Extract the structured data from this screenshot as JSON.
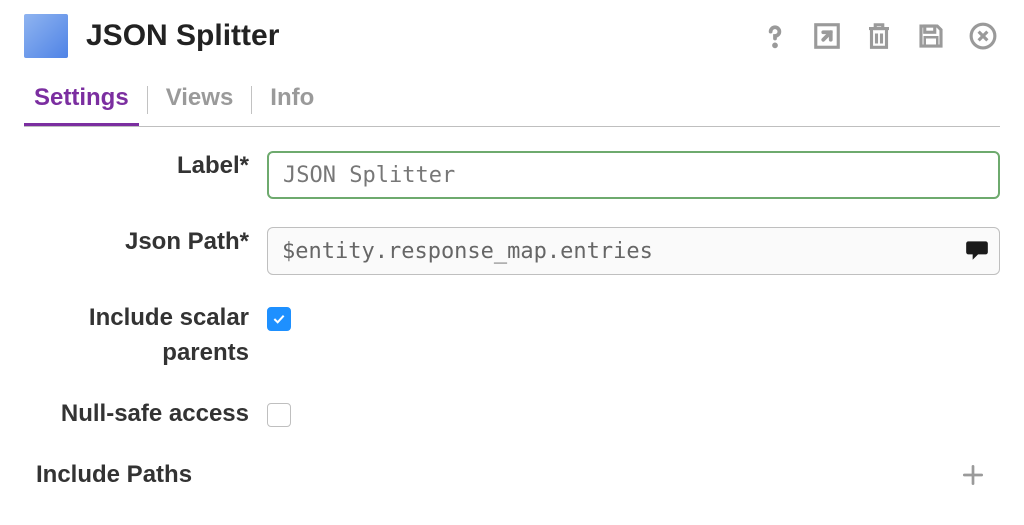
{
  "header": {
    "title": "JSON Splitter",
    "icons": {
      "help": "help-icon",
      "popout": "popout-icon",
      "delete": "trash-icon",
      "save": "save-icon",
      "close": "close-circle-icon"
    }
  },
  "tabs": {
    "active_index": 0,
    "items": [
      "Settings",
      "Views",
      "Info"
    ]
  },
  "form": {
    "label": {
      "label": "Label*",
      "value": "JSON Splitter"
    },
    "jsonPath": {
      "label": "Json Path*",
      "value": "$entity.response_map.entries"
    },
    "includeScalarParents": {
      "label": "Include scalar parents",
      "checked": true
    },
    "nullSafeAccess": {
      "label": "Null-safe access",
      "checked": false
    },
    "includePaths": {
      "label": "Include Paths"
    }
  },
  "colors": {
    "accent": "#7b2ea0",
    "focusBorder": "#6eaa6e",
    "checkbox": "#1e90ff",
    "muted": "#9a9a9a"
  }
}
